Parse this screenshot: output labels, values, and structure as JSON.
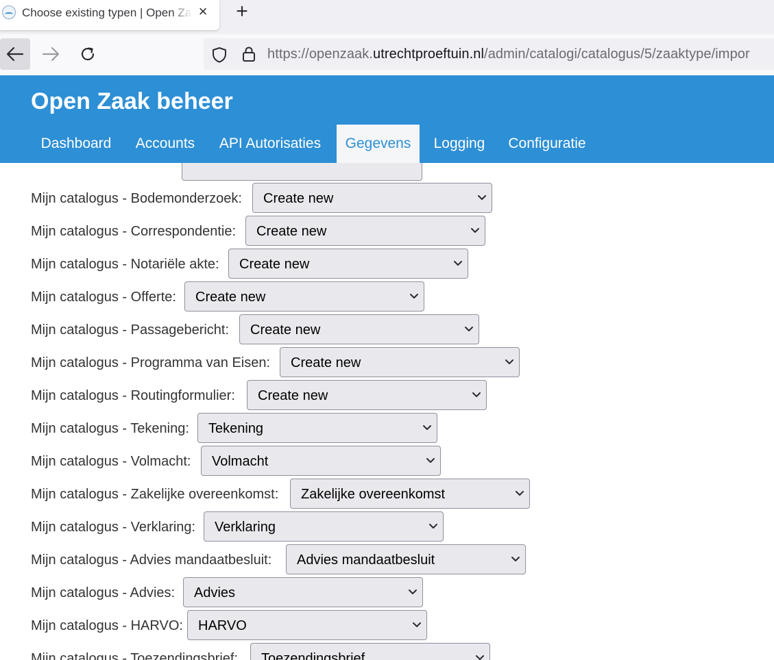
{
  "browser": {
    "tab_title": "Choose existing typen | Open Zaak",
    "url_prefix": "https://openzaak.",
    "url_host": "utrechtproeftuin.nl",
    "url_path": "/admin/catalogi/catalogus/5/zaaktype/impor"
  },
  "header": {
    "title": "Open Zaak beheer",
    "nav": [
      {
        "label": "Dashboard"
      },
      {
        "label": "Accounts"
      },
      {
        "label": "API Autorisaties"
      },
      {
        "label": "Gegevens",
        "active": true
      },
      {
        "label": "Logging"
      },
      {
        "label": "Configuratie"
      }
    ]
  },
  "rows": [
    {
      "label": "Mijn catalogus - Bodemonderzoek:",
      "value": "Create new"
    },
    {
      "label": "Mijn catalogus - Correspondentie:",
      "value": "Create new"
    },
    {
      "label": "Mijn catalogus - Notariële akte:",
      "value": "Create new"
    },
    {
      "label": "Mijn catalogus - Offerte:",
      "value": "Create new"
    },
    {
      "label": "Mijn catalogus - Passagebericht:",
      "value": "Create new"
    },
    {
      "label": "Mijn catalogus - Programma van Eisen:",
      "value": "Create new"
    },
    {
      "label": "Mijn catalogus - Routingformulier:",
      "value": "Create new"
    },
    {
      "label": "Mijn catalogus - Tekening:",
      "value": "Tekening"
    },
    {
      "label": "Mijn catalogus - Volmacht:",
      "value": "Volmacht"
    },
    {
      "label": "Mijn catalogus - Zakelijke overeenkomst:",
      "value": "Zakelijke overeenkomst"
    },
    {
      "label": "Mijn catalogus - Verklaring:",
      "value": "Verklaring"
    },
    {
      "label": "Mijn catalogus - Advies mandaatbesluit:",
      "value": "Advies mandaatbesluit"
    },
    {
      "label": "Mijn catalogus - Advies:",
      "value": "Advies"
    },
    {
      "label": "Mijn catalogus - HARVO:",
      "value": "HARVO"
    },
    {
      "label": "Mijn catalogus - Toezendingsbrief:",
      "value": "Toezendingsbrief"
    }
  ],
  "icons": {
    "back": "arrow-left-icon",
    "forward": "arrow-right-icon",
    "reload": "reload-icon",
    "shield": "shield-icon",
    "lock": "lock-icon",
    "close": "close-icon",
    "new_tab": "plus-icon",
    "chevron": "chevron-down-icon"
  },
  "colors": {
    "brand": "#2d8fd5",
    "select_bg": "#e9e9ed"
  }
}
